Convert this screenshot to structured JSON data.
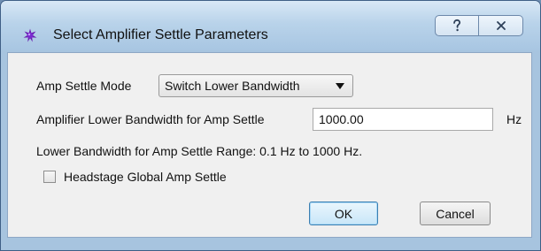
{
  "window": {
    "title": "Select Amplifier Settle Parameters",
    "icon": "purple-star-icon",
    "caption_buttons": {
      "help_icon": "question-mark-icon",
      "close_icon": "close-x-icon"
    }
  },
  "form": {
    "amp_settle_mode_label": "Amp Settle Mode",
    "amp_settle_mode_value": "Switch Lower Bandwidth",
    "lower_bandwidth_label": "Amplifier Lower Bandwidth for Amp Settle",
    "lower_bandwidth_value": "1000.00",
    "lower_bandwidth_unit": "Hz",
    "range_text": "Lower Bandwidth for Amp Settle Range: 0.1 Hz to 1000 Hz.",
    "global_checkbox_label": "Headstage Global Amp Settle",
    "global_checkbox_checked": false
  },
  "buttons": {
    "ok_label": "OK",
    "cancel_label": "Cancel"
  },
  "colors": {
    "accent_ok_border": "#3c7fb1",
    "window_frame": "#a7c4df",
    "dialog_background": "#f0f0f0",
    "icon_purple": "#6a1fb0"
  }
}
